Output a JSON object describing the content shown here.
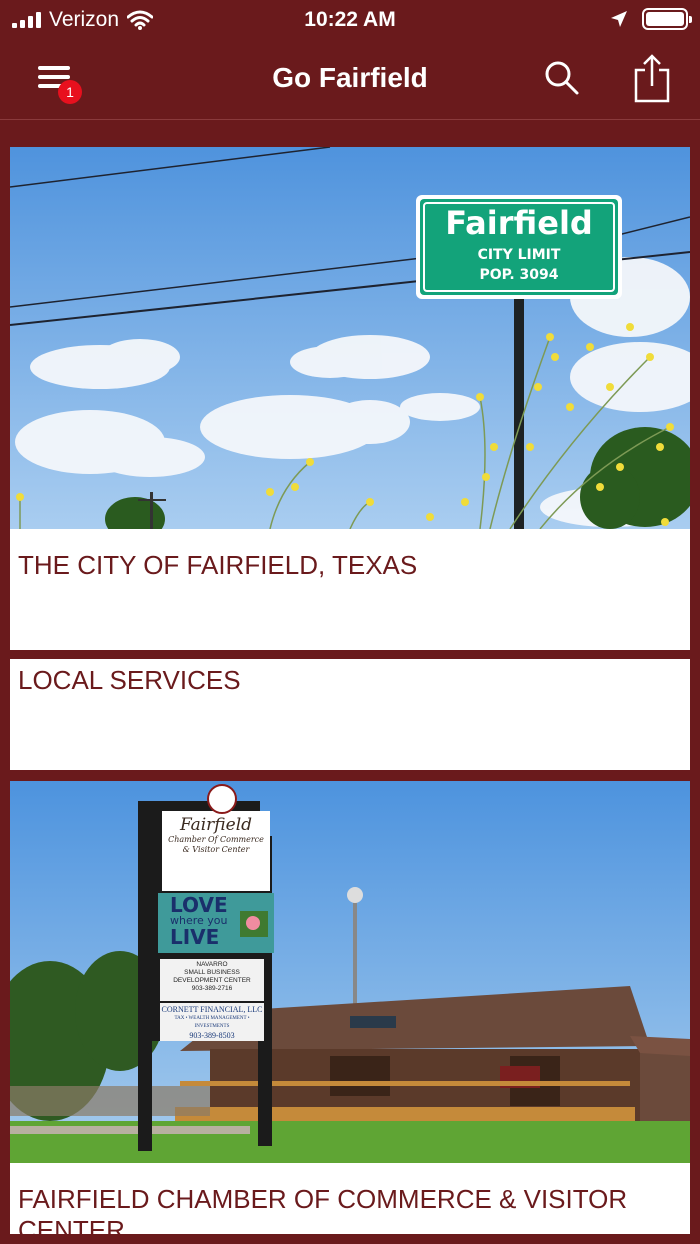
{
  "status_bar": {
    "carrier": "Verizon",
    "time": "10:22 AM"
  },
  "nav": {
    "title": "Go Fairfield",
    "badge_count": "1",
    "menu_icon": "hamburger-menu-icon",
    "search_icon": "search-icon",
    "share_icon": "share-icon"
  },
  "cards": [
    {
      "title": "THE CITY OF FAIRFIELD, TEXAS",
      "sign": {
        "name": "Fairfield",
        "line1": "CITY LIMIT",
        "line2": "POP. 3094"
      }
    },
    {
      "title": "LOCAL SERVICES"
    },
    {
      "title": "FAIRFIELD CHAMBER OF COMMERCE & VISITOR CENTER",
      "sign": {
        "name": "Fairfield",
        "sub1": "Chamber Of Commerce",
        "sub2": "& Visitor Center",
        "love1": "LOVE",
        "love2": "where you",
        "love3": "LIVE",
        "panel1a": "NAVARRO",
        "panel1b": "SMALL BUSINESS",
        "panel1c": "DEVELOPMENT CENTER",
        "panel1d": "903-389-2716",
        "panel2a": "CORNETT FINANCIAL, LLC",
        "panel2b": "TAX • WEALTH MANAGEMENT • INVESTMENTS",
        "panel2c": "903-389-8503"
      }
    }
  ],
  "colors": {
    "primary": "#6a1a1c",
    "badge": "#e8101e",
    "sky": "#5a9ee0",
    "sign_green": "#13a37a"
  }
}
